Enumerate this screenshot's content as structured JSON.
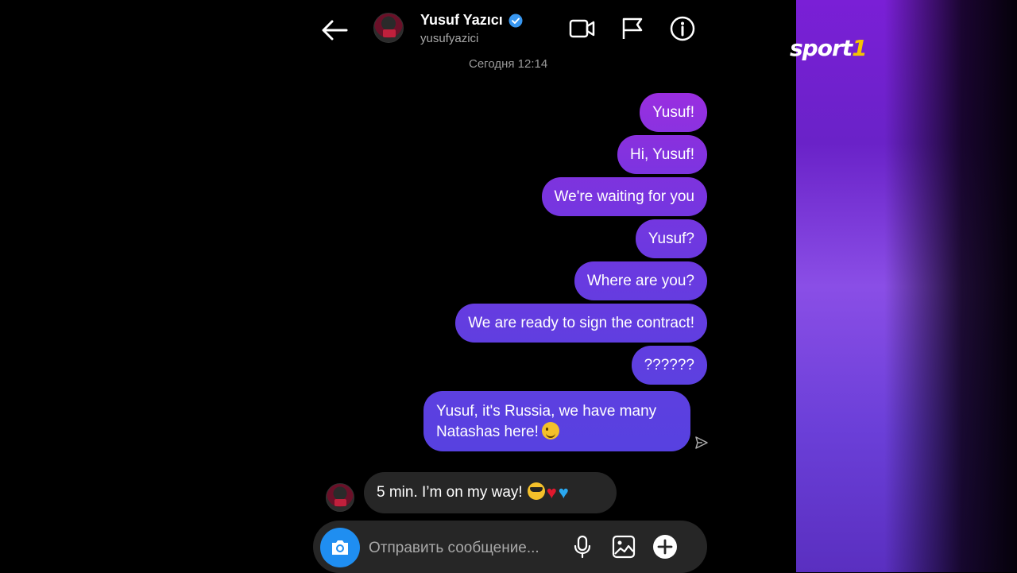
{
  "header": {
    "name": "Yusuf Yazıcı",
    "handle": "yusufyazici",
    "timestamp": "Сегодня 12:14"
  },
  "messages_out": [
    "Yusuf!",
    "Hi, Yusuf!",
    "We're waiting for you",
    "Yusuf?",
    "Where are you?",
    "We are ready to sign the contract!",
    "??????"
  ],
  "last_out": {
    "line1": "Yusuf, it's Russia, we have many",
    "line2": "Natashas here!"
  },
  "incoming": {
    "text": "5 min. I’m on my way!"
  },
  "composer": {
    "placeholder": "Отправить сообщение..."
  },
  "brand": {
    "text": "sport",
    "number": "1"
  },
  "colors": {
    "bubble_top": "#9a2bdc",
    "bubble_bottom": "#5b3ee0",
    "accent_blue": "#1f8ef1",
    "verified": "#3897f0"
  }
}
